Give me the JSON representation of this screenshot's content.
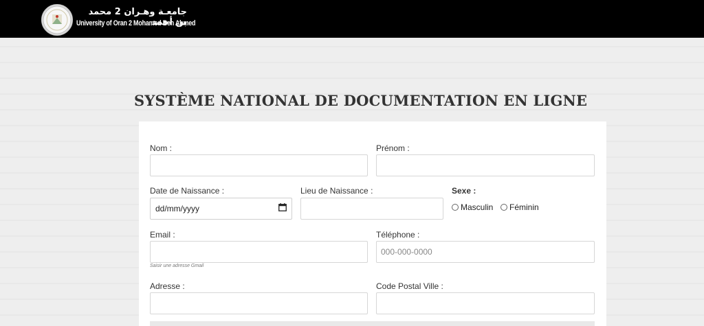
{
  "header": {
    "university_name_ar": "جامعـة وهـران 2 محمد بن أحمد",
    "university_name_en": "University of Oran 2 Mohamed Ben Ahmed"
  },
  "page": {
    "title": "SYSTÈME NATIONAL DE DOCUMENTATION EN LIGNE"
  },
  "form": {
    "nom": {
      "label": "Nom :",
      "value": ""
    },
    "prenom": {
      "label": "Prénom :",
      "value": ""
    },
    "date_naissance": {
      "label": "Date de Naissance :",
      "value": "dd/mm/yyyy"
    },
    "lieu_naissance": {
      "label": "Lieu de Naissance :",
      "value": ""
    },
    "sexe": {
      "label": "Sexe :",
      "options": [
        "Masculin",
        "Féminin"
      ]
    },
    "email": {
      "label": "Email :",
      "value": "",
      "help": "Saisir une adresse Gmail"
    },
    "telephone": {
      "label": "Téléphone :",
      "value": "",
      "placeholder": "000-000-0000"
    },
    "adresse": {
      "label": "Adresse :",
      "value": ""
    },
    "code_postal_ville": {
      "label": "Code Postal Ville :",
      "value": ""
    }
  }
}
